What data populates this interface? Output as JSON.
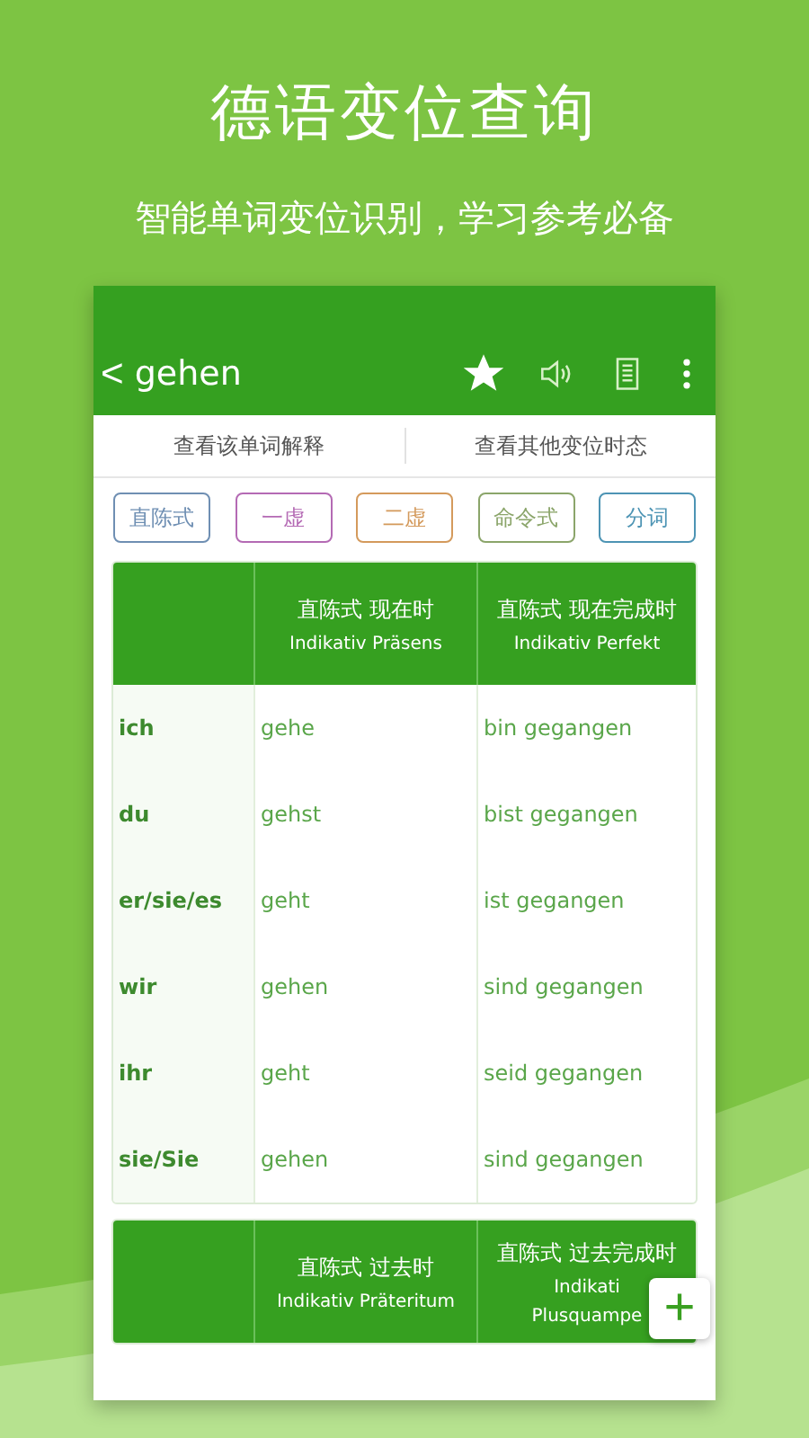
{
  "headline": "德语变位查询",
  "tagline": "智能单词变位识别，学习参考必备",
  "app_bar": {
    "back": "<",
    "word": "gehen",
    "favorited": true
  },
  "tabs": [
    {
      "label": "查看该单词解释"
    },
    {
      "label": "查看其他变位时态"
    }
  ],
  "moods": [
    {
      "label": "直陈式",
      "color": "#6f8fb3"
    },
    {
      "label": "一虚",
      "color": "#b46ab4"
    },
    {
      "label": "二虚",
      "color": "#d49a5c"
    },
    {
      "label": "命令式",
      "color": "#8ba56a"
    },
    {
      "label": "分词",
      "color": "#4d94b4"
    }
  ],
  "tables": [
    {
      "columns": [
        {
          "zh": "直陈式 现在时",
          "de": [
            "Indikativ Präsens"
          ]
        },
        {
          "zh": "直陈式 现在完成时",
          "de": [
            "Indikativ Perfekt"
          ]
        }
      ],
      "rows": [
        {
          "pronoun": "ich",
          "cells": [
            "gehe",
            "bin gegangen"
          ]
        },
        {
          "pronoun": "du",
          "cells": [
            "gehst",
            "bist gegangen"
          ]
        },
        {
          "pronoun": "er/sie/es",
          "cells": [
            "geht",
            "ist gegangen"
          ]
        },
        {
          "pronoun": "wir",
          "cells": [
            "gehen",
            "sind gegangen"
          ]
        },
        {
          "pronoun": "ihr",
          "cells": [
            "geht",
            "seid gegangen"
          ]
        },
        {
          "pronoun": "sie/Sie",
          "cells": [
            "gehen",
            "sind gegangen"
          ]
        }
      ]
    },
    {
      "columns": [
        {
          "zh": "直陈式 过去时",
          "de": [
            "Indikativ Präteritum"
          ]
        },
        {
          "zh": "直陈式 过去完成时",
          "de": [
            "Indikati",
            "Plusquampe"
          ]
        }
      ]
    }
  ],
  "fab": "+"
}
